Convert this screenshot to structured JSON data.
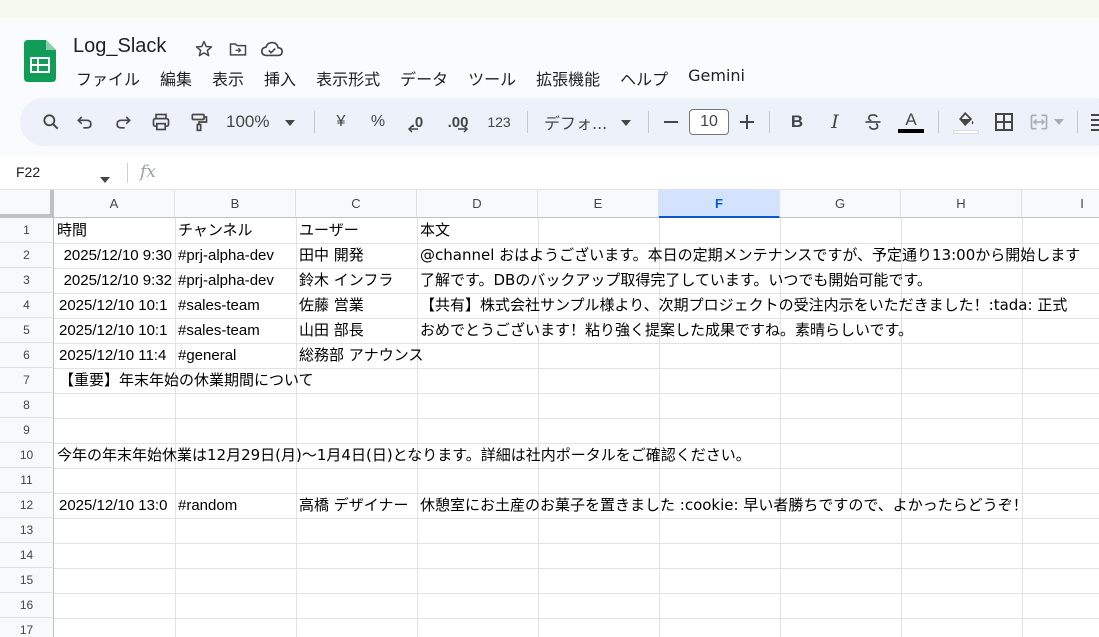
{
  "doc": {
    "title": "Log_Slack"
  },
  "menu": [
    "ファイル",
    "編集",
    "表示",
    "挿入",
    "表示形式",
    "データ",
    "ツール",
    "拡張機能",
    "ヘルプ",
    "Gemini"
  ],
  "toolbar": {
    "zoom": "100%",
    "currency": "¥",
    "percent": "%",
    "decrease_decimal": ".0",
    "increase_decimal": ".00",
    "number_format": "123",
    "font": "デフォ...",
    "font_size": "10",
    "bold": "B",
    "italic": "I",
    "text_color_letter": "A"
  },
  "formula_bar": {
    "name_box": "F22",
    "fx": "fx"
  },
  "columns": [
    "A",
    "B",
    "C",
    "D",
    "E",
    "F",
    "G",
    "H",
    "I"
  ],
  "selected_column": "F",
  "rows": [
    "1",
    "2",
    "3",
    "4",
    "5",
    "6",
    "7",
    "8",
    "9",
    "10",
    "11",
    "12",
    "13",
    "14",
    "15",
    "16",
    "17"
  ],
  "cells": {
    "r1": {
      "A": "時間",
      "B": "チャンネル",
      "C": "ユーザー",
      "D": "本文"
    },
    "r2": {
      "A": "2025/12/10 9:30",
      "B": "#prj-alpha-dev",
      "C": "田中 開発",
      "D": "@channel おはようございます。本日の定期メンテナンスですが、予定通り13:00から開始します"
    },
    "r3": {
      "A": "2025/12/10 9:32",
      "B": "#prj-alpha-dev",
      "C": "鈴木 インフラ",
      "D": "了解です。DBのバックアップ取得完了しています。いつでも開始可能です。"
    },
    "r4": {
      "A": "2025/12/10 10:1",
      "B": "#sales-team",
      "C": "佐藤 営業",
      "D": "【共有】株式会社サンプル様より、次期プロジェクトの受注内示をいただきました！:tada: 正式"
    },
    "r5": {
      "A": "2025/12/10 10:1",
      "B": "#sales-team",
      "C": "山田 部長",
      "D": "おめでとうございます！粘り強く提案した成果ですね。素晴らしいです。"
    },
    "r6": {
      "A": "2025/12/10 11:4",
      "B": "#general",
      "C": "総務部 アナウンス"
    },
    "r7": {
      "A": "【重要】年末年始の休業期間について"
    },
    "r10": {
      "A": "今年の年末年始休業は12月29日(月)〜1月4日(日)となります。詳細は社内ポータルをご確認ください。"
    },
    "r12": {
      "A": "2025/12/10 13:0",
      "B": "#random",
      "C": "高橋 デザイナー",
      "D": "休憩室にお土産のお菓子を置きました :cookie: 早い者勝ちですので、よかったらどうぞ！"
    }
  }
}
